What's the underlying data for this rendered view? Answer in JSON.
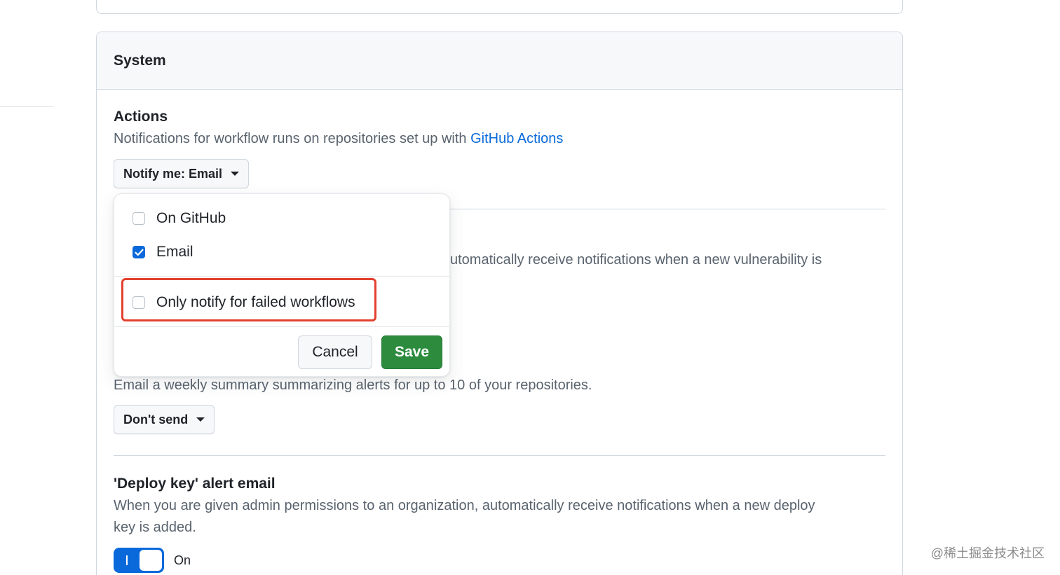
{
  "system_box": {
    "title": "System"
  },
  "actions": {
    "title": "Actions",
    "desc_prefix": "Notifications for workflow runs on repositories set up with ",
    "desc_link": "GitHub Actions",
    "notify_button": "Notify me: Email",
    "dropdown": {
      "options": [
        {
          "label": "On GitHub",
          "checked": false
        },
        {
          "label": "Email",
          "checked": true
        }
      ],
      "failed_only": {
        "label": "Only notify for failed workflows",
        "checked": false
      },
      "cancel": "Cancel",
      "save": "Save"
    }
  },
  "vulnerability": {
    "desc_partial": "utomatically receive notifications when a new vulnerability is"
  },
  "weekly_digest": {
    "desc": "Email a weekly summary summarizing alerts for up to 10 of your repositories.",
    "button": "Don't send"
  },
  "deploy_key": {
    "title": "'Deploy key' alert email",
    "desc_line1": "When you are given admin permissions to an organization, automatically receive notifications when a new deploy",
    "desc_line2": "key is added.",
    "toggle_label": "On"
  },
  "watermark": "@稀土掘金技术社区",
  "colors": {
    "accent": "#0969da",
    "save_green": "#2c8b3d",
    "highlight_red": "#e2402e"
  }
}
